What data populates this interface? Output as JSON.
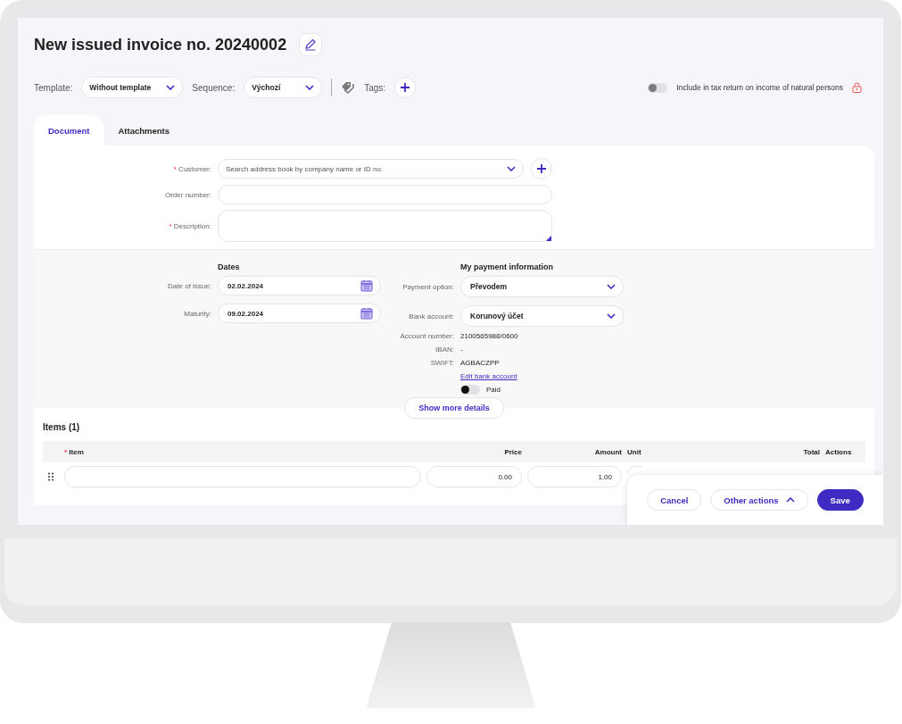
{
  "title": "New issued invoice no. 20240002",
  "required_mark": "*",
  "toolbar": {
    "template_label": "Template:",
    "template_value": "Without template",
    "sequence_label": "Sequence:",
    "sequence_value": "Výchozí",
    "tags_label": "Tags:",
    "tax_toggle": {
      "label": "Include in tax return on income of natural persons",
      "on": false
    }
  },
  "tabs": [
    {
      "label": "Document",
      "selected": true
    },
    {
      "label": "Attachments",
      "selected": false
    }
  ],
  "form": [
    {
      "label": "Customer:",
      "required": true,
      "kind": "search",
      "placeholder": "Search address book by company name or ID no."
    },
    {
      "label": "Order number:",
      "required": false,
      "kind": "text"
    },
    {
      "label": "Description:",
      "required": true,
      "kind": "textarea"
    }
  ],
  "dates": {
    "heading": "Dates",
    "fields": [
      {
        "label": "Date of issue:",
        "value": "02.02.2024"
      },
      {
        "label": "Maturity:",
        "value": "09.02.2024"
      }
    ]
  },
  "payment": {
    "heading": "My payment information",
    "selects": [
      {
        "label": "Payment option:",
        "value": "Převodem"
      },
      {
        "label": "Bank account:",
        "value": "Korunový účet"
      }
    ],
    "details": [
      {
        "label": "Account number:",
        "value": "2100565988/0600"
      },
      {
        "label": "IBAN:",
        "value": "-"
      },
      {
        "label": "SWIFT:",
        "value": "AGBACZPP"
      }
    ],
    "edit_link": "Edit bank account",
    "paid_toggle": {
      "label": "Paid",
      "on": false
    }
  },
  "show_more": "Show more details",
  "items": {
    "title": "Items (1)",
    "columns": [
      {
        "label": "Item",
        "required": true
      },
      {
        "label": "Price",
        "required": false
      },
      {
        "label": "Amount",
        "required": false
      },
      {
        "label": "Unit",
        "required": false
      },
      {
        "label": "Total",
        "required": false
      },
      {
        "label": "Actions",
        "required": false
      }
    ],
    "rows": [
      {
        "price": "0.00",
        "amount": "1.00"
      }
    ]
  },
  "footer": [
    {
      "label": "Cancel",
      "kind": "secondary"
    },
    {
      "label": "Other actions",
      "kind": "menu"
    },
    {
      "label": "Save",
      "kind": "primary"
    }
  ]
}
